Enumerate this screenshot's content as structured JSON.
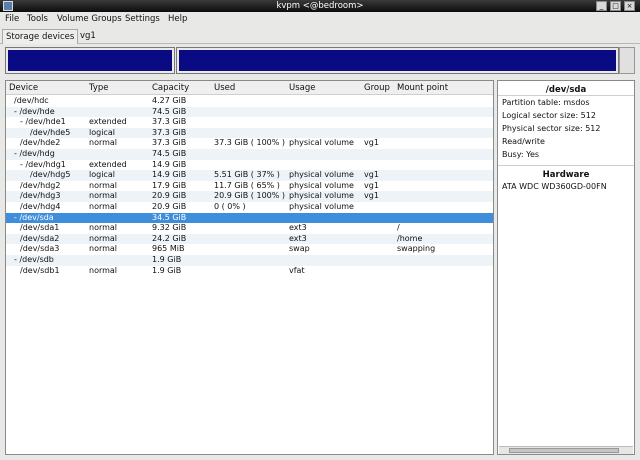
{
  "window": {
    "title": "kvpm <@bedroom>"
  },
  "menu": {
    "file": "File",
    "tools": "Tools",
    "volume_groups": "Volume Groups",
    "settings": "Settings",
    "help": "Help"
  },
  "tabs": {
    "storage": "Storage devices",
    "vg1": "vg1"
  },
  "columns": [
    "Device",
    "Type",
    "Capacity",
    "Used",
    "Usage",
    "Group",
    "Mount point"
  ],
  "rows": [
    {
      "prefix": "",
      "device": "/dev/hdc",
      "type": "",
      "capacity": "4.27 GiB",
      "used": "",
      "usage": "",
      "group": "",
      "mount": ""
    },
    {
      "prefix": "- ",
      "device": "/dev/hde",
      "type": "",
      "capacity": "74.5 GiB",
      "used": "",
      "usage": "",
      "group": "",
      "mount": ""
    },
    {
      "prefix": "- ",
      "device": "/dev/hde1",
      "type": "extended",
      "capacity": "37.3 GiB",
      "used": "",
      "usage": "",
      "group": "",
      "mount": ""
    },
    {
      "prefix": "",
      "device": "/dev/hde5",
      "type": "logical",
      "capacity": "37.3 GiB",
      "used": "",
      "usage": "",
      "group": "",
      "mount": ""
    },
    {
      "prefix": "",
      "device": "/dev/hde2",
      "type": "normal",
      "capacity": "37.3 GiB",
      "used": "37.3 GiB ( 100% )",
      "usage": "physical volume",
      "group": "vg1",
      "mount": ""
    },
    {
      "prefix": "- ",
      "device": "/dev/hdg",
      "type": "",
      "capacity": "74.5 GiB",
      "used": "",
      "usage": "",
      "group": "",
      "mount": ""
    },
    {
      "prefix": "- ",
      "device": "/dev/hdg1",
      "type": "extended",
      "capacity": "14.9 GiB",
      "used": "",
      "usage": "",
      "group": "",
      "mount": ""
    },
    {
      "prefix": "",
      "device": "/dev/hdg5",
      "type": "logical",
      "capacity": "14.9 GiB",
      "used": "5.51 GiB ( 37% )",
      "usage": "physical volume",
      "group": "vg1",
      "mount": ""
    },
    {
      "prefix": "",
      "device": "/dev/hdg2",
      "type": "normal",
      "capacity": "17.9 GiB",
      "used": "11.7 GiB ( 65% )",
      "usage": "physical volume",
      "group": "vg1",
      "mount": ""
    },
    {
      "prefix": "",
      "device": "/dev/hdg3",
      "type": "normal",
      "capacity": "20.9 GiB",
      "used": "20.9 GiB ( 100% )",
      "usage": "physical volume",
      "group": "vg1",
      "mount": ""
    },
    {
      "prefix": "",
      "device": "/dev/hdg4",
      "type": "normal",
      "capacity": "20.9 GiB",
      "used": "0 ( 0% )",
      "usage": "physical volume",
      "group": "",
      "mount": ""
    },
    {
      "prefix": "- ",
      "device": "/dev/sda",
      "type": "",
      "capacity": "34.5 GiB",
      "used": "",
      "usage": "",
      "group": "",
      "mount": ""
    },
    {
      "prefix": "",
      "device": "/dev/sda1",
      "type": "normal",
      "capacity": "9.32 GiB",
      "used": "",
      "usage": "ext3",
      "group": "",
      "mount": "/"
    },
    {
      "prefix": "",
      "device": "/dev/sda2",
      "type": "normal",
      "capacity": "24.2 GiB",
      "used": "",
      "usage": "ext3",
      "group": "",
      "mount": "/home"
    },
    {
      "prefix": "",
      "device": "/dev/sda3",
      "type": "normal",
      "capacity": "965 MiB",
      "used": "",
      "usage": "swap",
      "group": "",
      "mount": "swapping"
    },
    {
      "prefix": "- ",
      "device": "/dev/sdb",
      "type": "",
      "capacity": "1.9 GiB",
      "used": "",
      "usage": "",
      "group": "",
      "mount": ""
    },
    {
      "prefix": "",
      "device": "/dev/sdb1",
      "type": "normal",
      "capacity": "1.9 GiB",
      "used": "",
      "usage": "vfat",
      "group": "",
      "mount": ""
    }
  ],
  "selected_row": 11,
  "details": {
    "device": "/dev/sda",
    "partition_table": "Partition table: msdos",
    "logical_sector": "Logical sector size: 512",
    "physical_sector": "Physical sector size: 512",
    "access": "Read/write",
    "busy": "Busy: Yes",
    "hardware_header": "Hardware",
    "hardware_model": "ATA WDC WD360GD-00FN"
  },
  "colors": {
    "map_bar": "#0a0a82",
    "selection": "#3e8edc"
  }
}
